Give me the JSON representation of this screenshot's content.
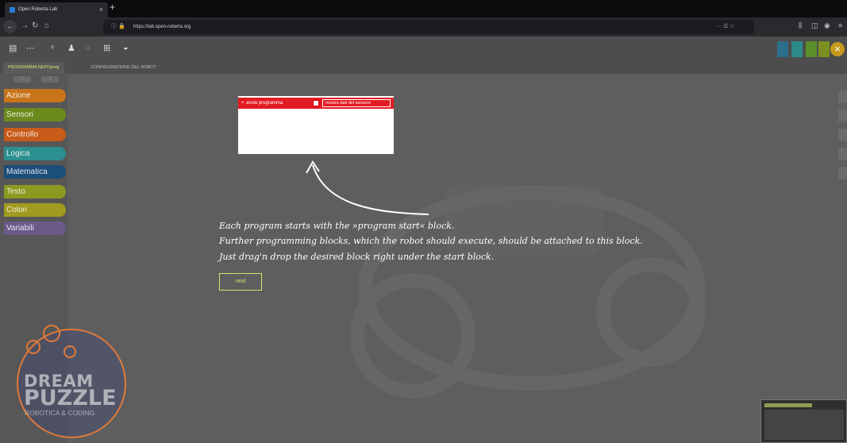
{
  "browser": {
    "tab_title": "Open Roberta Lab",
    "tab_close": "×",
    "new_tab": "+",
    "url": "https://lab.open-roberta.org",
    "page_actions": "··· ☰ ☆"
  },
  "app": {
    "tabs": [
      {
        "label": "PROGRAMMA NEPOprog"
      },
      {
        "label": "CONFIGURAZIONE DEL ROBOT"
      }
    ],
    "close_symbol": "×",
    "level_tabs": [
      "1",
      "2"
    ],
    "categories": [
      {
        "label": "Azione",
        "color": "#c8741a"
      },
      {
        "label": "Sensori",
        "color": "#6b8a1c"
      },
      {
        "label": "Controllo",
        "color": "#c85a1a"
      },
      {
        "label": "Logica",
        "color": "#2d8f8f"
      },
      {
        "label": "Matematica",
        "color": "#1c4e7a"
      },
      {
        "label": "Testo",
        "color": "#8a9a20"
      },
      {
        "label": "Colori",
        "color": "#a09a1e"
      },
      {
        "label": "Variabili",
        "color": "#6a5a8a"
      }
    ]
  },
  "program": {
    "start_block": "avvia programma",
    "sensor_label": "mostra dati del sensore",
    "block_color": "#e31b23"
  },
  "tutorial": {
    "line1": "Each program starts with the »program start« block.",
    "line2": "Further programming blocks, which the robot should execute, should be attached to this block.",
    "line3": "Just drag'n drop the desired block right under the start block.",
    "next_label": "next",
    "accent_color": "#d6e36a"
  },
  "watermark": {
    "line1": "DREAM",
    "line2": "PUZZLE",
    "line3": "ROBOTICA & CODING",
    "color": "#e07a3a"
  }
}
